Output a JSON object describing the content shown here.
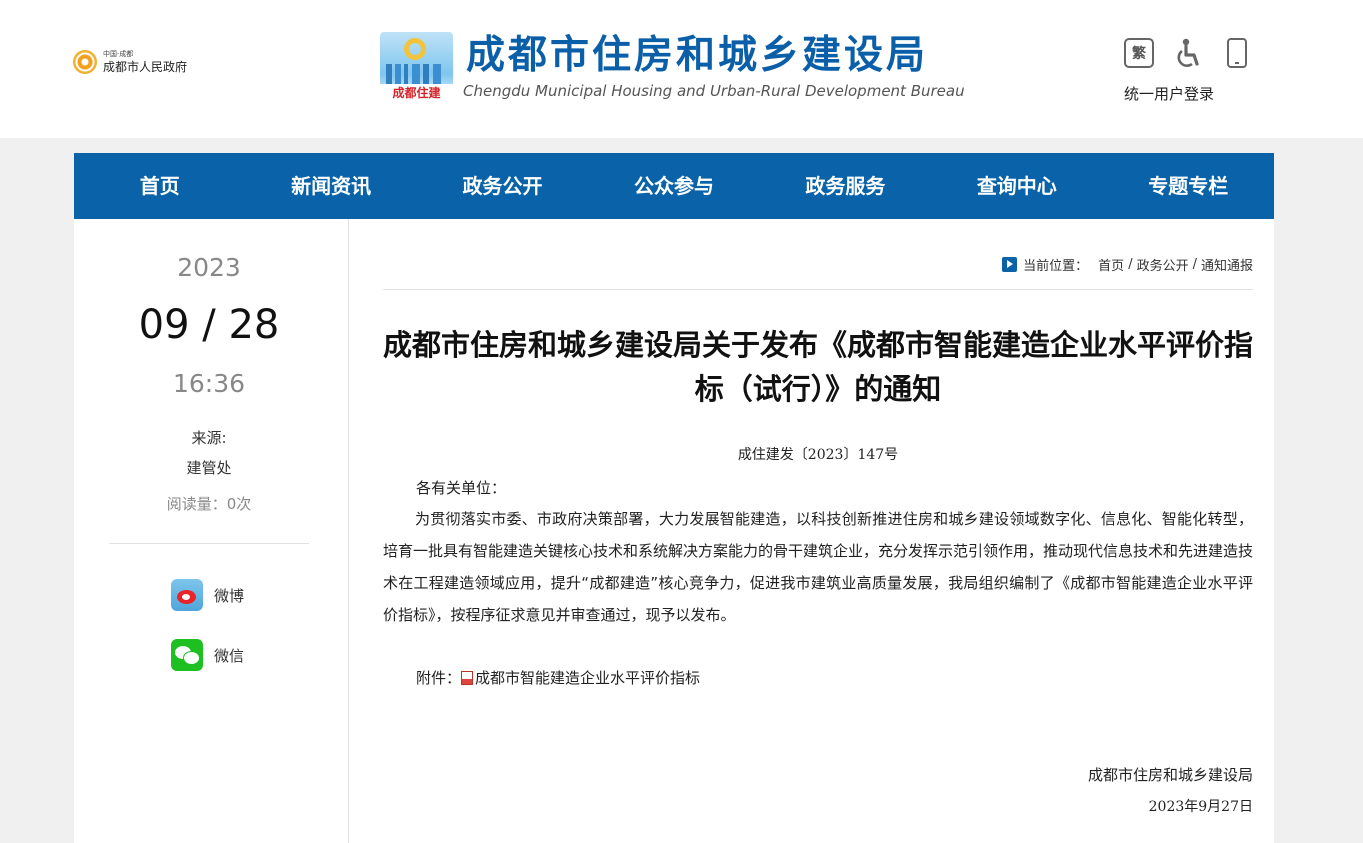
{
  "header": {
    "gov_small_text": "中国·成都",
    "gov_name": "成都市人民政府",
    "bureau_badge": "成都住建",
    "bureau_title": "成都市住房和城乡建设局",
    "bureau_subtitle": "Chengdu Municipal Housing and Urban-Rural Development Bureau",
    "traditional_label": "繁",
    "login_label": "统一用户登录"
  },
  "nav": {
    "items": [
      "首页",
      "新闻资讯",
      "政务公开",
      "公众参与",
      "政务服务",
      "查询中心",
      "专题专栏"
    ]
  },
  "sidebar": {
    "year": "2023",
    "date": "09 / 28",
    "time": "16:36",
    "source_label": "来源:",
    "source_value": "建管处",
    "views": "阅读量：0次",
    "share_weibo": "微博",
    "share_wechat": "微信"
  },
  "breadcrumb": {
    "label": "当前位置：",
    "items": [
      "首页",
      "政务公开",
      "通知通报"
    ]
  },
  "article": {
    "title": "成都市住房和城乡建设局关于发布《成都市智能建造企业水平评价指标（试行）》的通知",
    "doc_number": "成住建发〔2023〕147号",
    "salutation": "各有关单位：",
    "body": "为贯彻落实市委、市政府决策部署，大力发展智能建造，以科技创新推进住房和城乡建设领域数字化、信息化、智能化转型，培育一批具有智能建造关键核心技术和系统解决方案能力的骨干建筑企业，充分发挥示范引领作用，推动现代信息技术和先进建造技术在工程建造领域应用，提升“成都建造”核心竞争力，促进我市建筑业高质量发展，我局组织编制了《成都市智能建造企业水平评价指标》，按程序征求意见并审查通过，现予以发布。",
    "attachment_label": "附件：",
    "attachment_name": "成都市智能建造企业水平评价指标",
    "signature": "成都市住房和城乡建设局",
    "sign_date": "2023年9月27日"
  },
  "colors": {
    "nav_bg": "#0a63a8",
    "title_blue": "#0a5fa8",
    "page_bg": "#f0f0f0"
  }
}
